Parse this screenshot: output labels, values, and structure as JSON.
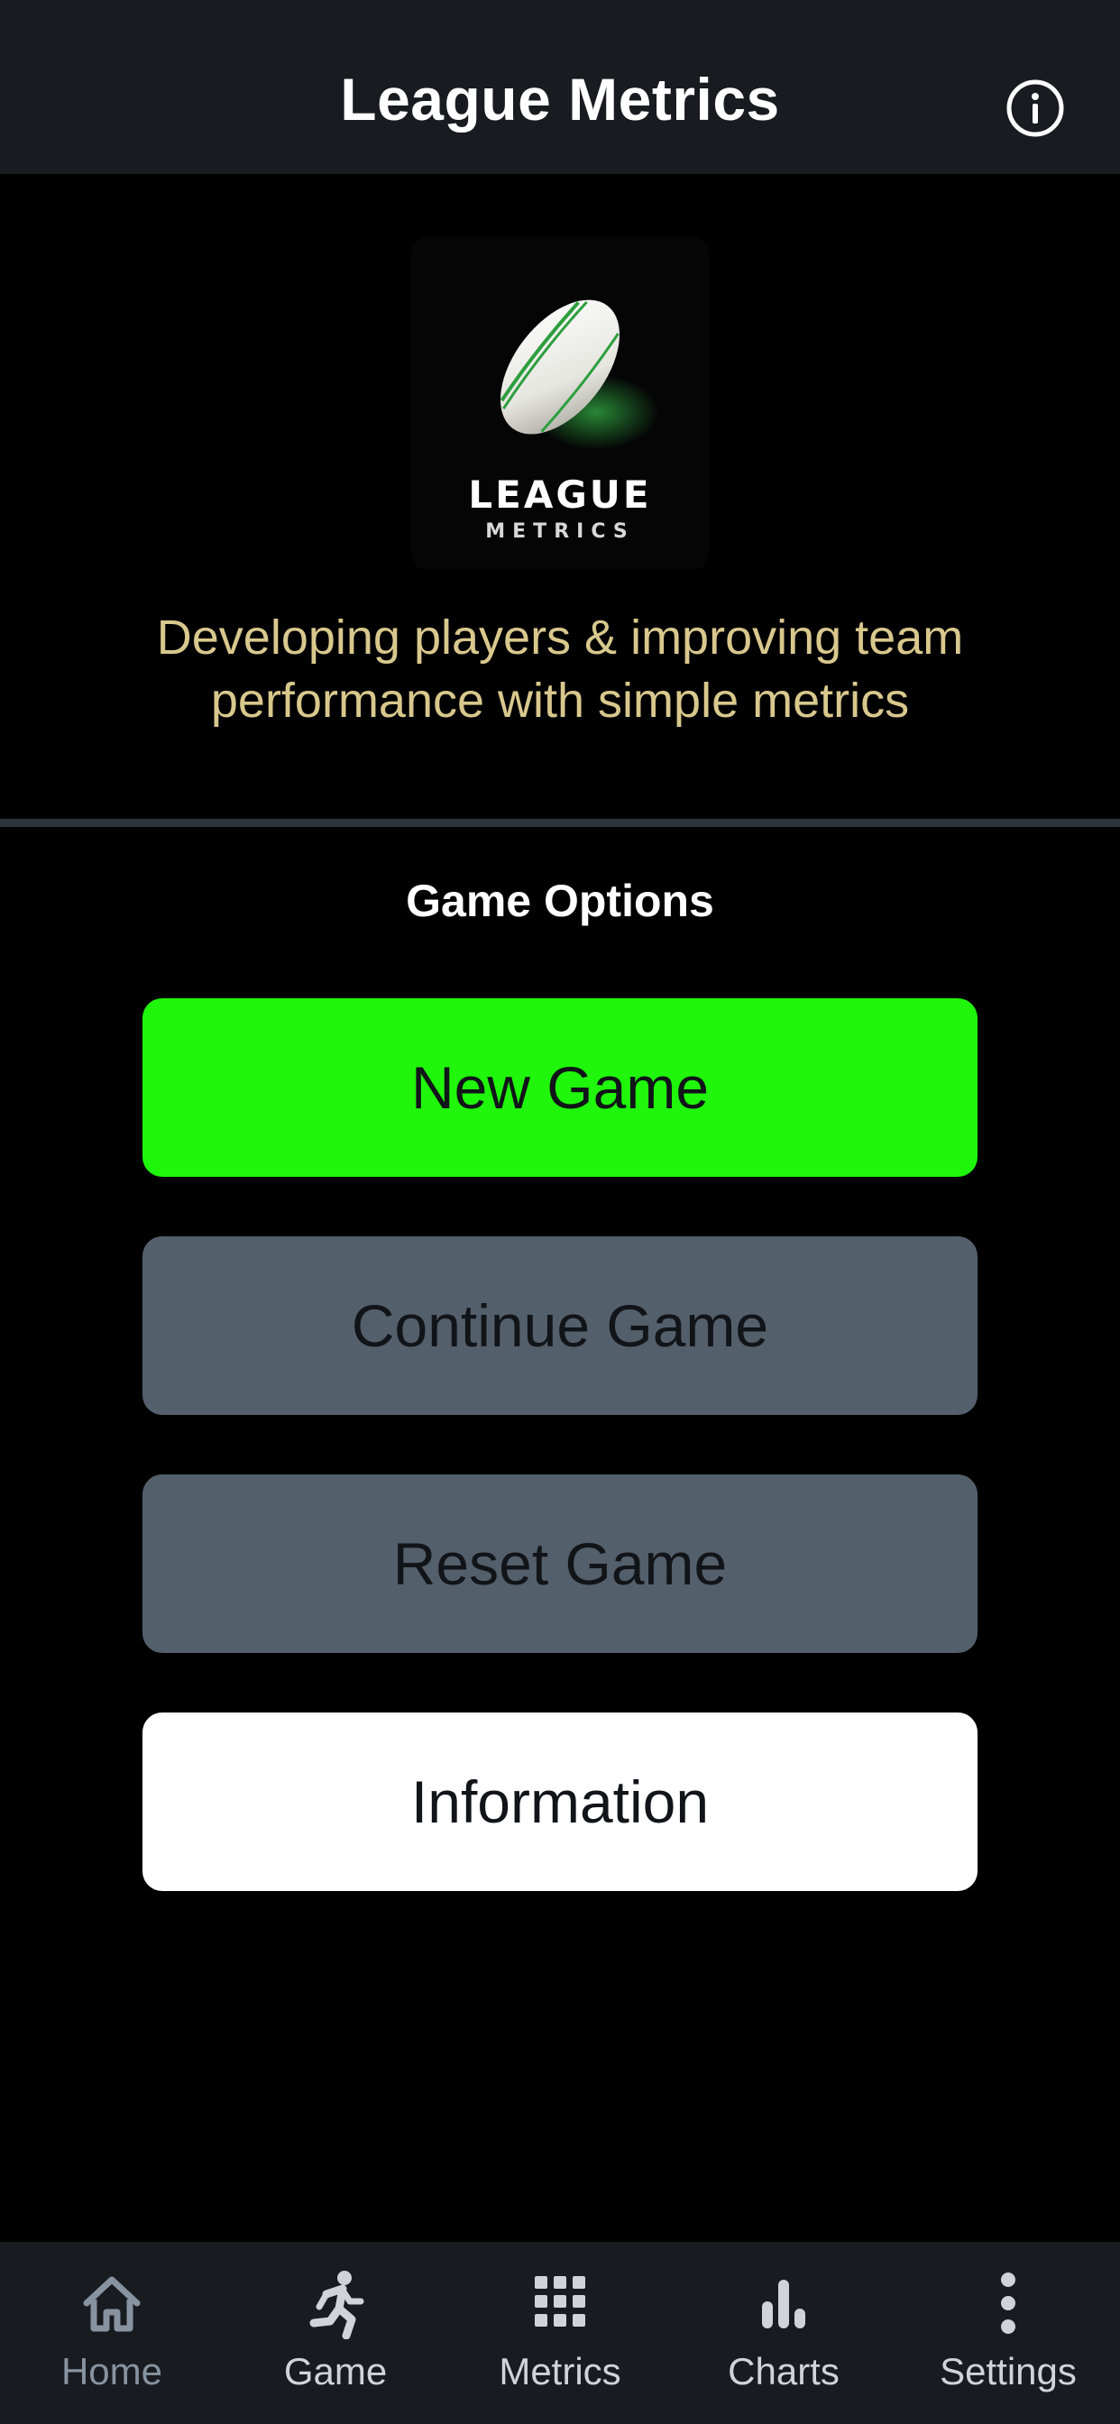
{
  "header": {
    "title": "League Metrics",
    "info_icon": "info-circle-icon"
  },
  "logo": {
    "icon": "rugby-ball-icon",
    "word_main": "LEAGUE",
    "word_sub": "METRICS",
    "accent_color": "#2e9e3e"
  },
  "tagline": "Developing players & improving team performance with simple metrics",
  "game_options": {
    "title": "Game Options",
    "buttons": [
      {
        "label": "New Game",
        "color": "#1ff60b"
      },
      {
        "label": "Continue Game",
        "color": "#535f6b"
      },
      {
        "label": "Reset Game",
        "color": "#535f6b"
      },
      {
        "label": "Information",
        "color": "#ffffff"
      }
    ]
  },
  "bottom_nav": {
    "active": "Home",
    "items": [
      {
        "label": "Home",
        "icon": "home-icon"
      },
      {
        "label": "Game",
        "icon": "running-person-icon"
      },
      {
        "label": "Metrics",
        "icon": "grid-icon"
      },
      {
        "label": "Charts",
        "icon": "bar-chart-icon"
      },
      {
        "label": "Settings",
        "icon": "more-vertical-icon"
      }
    ]
  },
  "colors": {
    "header_bg": "#181b20",
    "background": "#000000",
    "tagline": "#d9c88d",
    "divider": "#2c343e",
    "nav_active": "#8793a0"
  }
}
